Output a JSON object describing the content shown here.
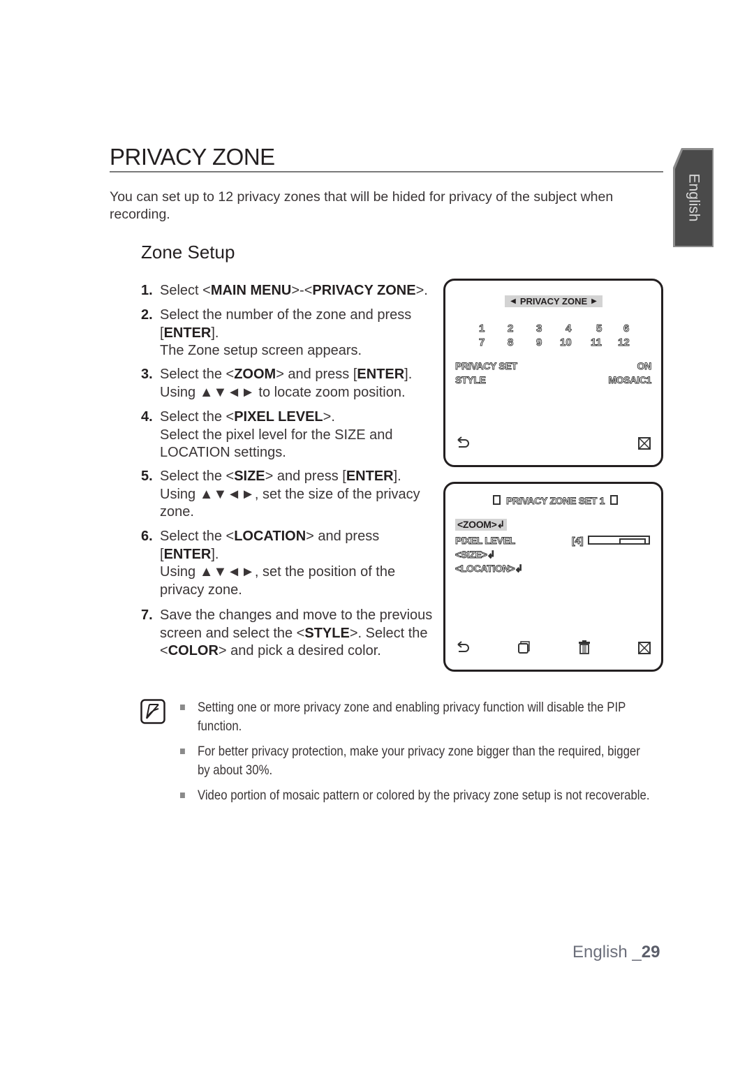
{
  "page": {
    "title": "PRIVACY ZONE",
    "intro": "You can set up to 12 privacy zones that will be hided for privacy of the subject when recording.",
    "section_title": "Zone Setup",
    "side_tab": "English",
    "footer": {
      "language": "English _",
      "page_number": "29"
    }
  },
  "steps": [
    {
      "num": "1.",
      "parts": [
        [
          "Select <",
          false
        ],
        [
          "MAIN MENU",
          true
        ],
        [
          ">-<",
          false
        ],
        [
          "PRIVACY ZONE",
          true
        ],
        [
          ">.",
          false
        ]
      ]
    },
    {
      "num": "2.",
      "parts": [
        [
          "Select the number of the zone and press [",
          false
        ],
        [
          "ENTER",
          true
        ],
        [
          "].",
          false
        ],
        [
          "\nThe Zone setup screen appears.",
          false
        ]
      ]
    },
    {
      "num": "3.",
      "parts": [
        [
          "Select the <",
          false
        ],
        [
          "ZOOM",
          true
        ],
        [
          "> and press [",
          false
        ],
        [
          "ENTER",
          true
        ],
        [
          "].",
          false
        ],
        [
          "\nUsing ▲▼◄► to locate zoom position.",
          false
        ]
      ]
    },
    {
      "num": "4.",
      "parts": [
        [
          "Select the <",
          false
        ],
        [
          "PIXEL LEVEL",
          true
        ],
        [
          ">.",
          false
        ],
        [
          "\nSelect the pixel level for the SIZE and LOCATION settings.",
          false
        ]
      ]
    },
    {
      "num": "5.",
      "parts": [
        [
          "Select the <",
          false
        ],
        [
          "SIZE",
          true
        ],
        [
          "> and press [",
          false
        ],
        [
          "ENTER",
          true
        ],
        [
          "].",
          false
        ],
        [
          "\nUsing ▲▼◄►, set the size of the privacy zone.",
          false
        ]
      ]
    },
    {
      "num": "6.",
      "parts": [
        [
          "Select the <",
          false
        ],
        [
          "LOCATION",
          true
        ],
        [
          "> and press [",
          false
        ],
        [
          "ENTER",
          true
        ],
        [
          "].",
          false
        ],
        [
          "\nUsing ▲▼◄►, set the position of the privacy zone.",
          false
        ]
      ]
    },
    {
      "num": "7.",
      "parts": [
        [
          "Save the changes and move to the previous screen and select the <",
          false
        ],
        [
          "STYLE",
          true
        ],
        [
          ">. Select the <",
          false
        ],
        [
          "COLOR",
          true
        ],
        [
          "> and pick a desired color.",
          false
        ]
      ]
    }
  ],
  "osd_privacy_zone": {
    "header": "PRIVACY ZONE",
    "zones_row1": [
      "1",
      "2",
      "3",
      "4",
      "5",
      "6"
    ],
    "zones_row2": [
      "7",
      "8",
      "9",
      "10",
      "11",
      "12"
    ],
    "rows": [
      {
        "label": "PRIVACY SET",
        "value": "ON"
      },
      {
        "label": "STYLE",
        "value": "MOSAIC1"
      }
    ],
    "icons": [
      "return-icon",
      "exit-icon"
    ]
  },
  "osd_zone_set": {
    "header": "PRIVACY ZONE SET 1",
    "items": [
      {
        "label": "<ZOOM>",
        "selected": true
      },
      {
        "label": "PIXEL LEVEL",
        "value": "[4]"
      },
      {
        "label": "<SIZE>"
      },
      {
        "label": "<LOCATION>"
      }
    ],
    "pixel_level": {
      "value": 4,
      "thumb_start_fraction": 0.5,
      "thumb_end_fraction": 1.0
    },
    "icons": [
      "return-icon",
      "save-window-icon",
      "trash-icon",
      "exit-icon"
    ]
  },
  "notes": [
    "Setting one or more privacy zone and enabling privacy function will disable the PIP function.",
    "For better privacy protection, make your privacy zone bigger than the required, bigger by about 30%.",
    "Video portion of mosaic pattern or colored by the privacy zone setup is not recoverable."
  ]
}
